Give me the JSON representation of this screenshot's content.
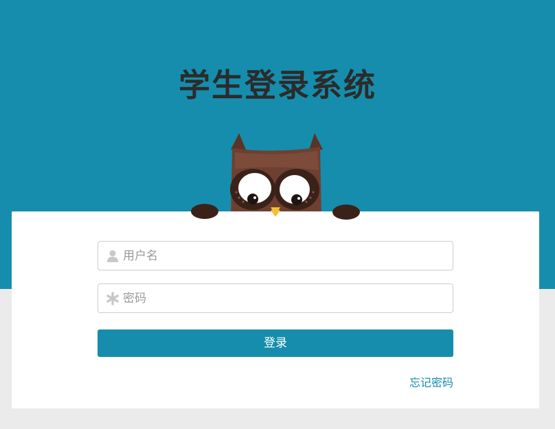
{
  "page": {
    "title": "学生登录系统"
  },
  "form": {
    "username": {
      "placeholder": "用户名",
      "value": "",
      "icon": "user-icon"
    },
    "password": {
      "placeholder": "密码",
      "value": "",
      "icon": "asterisk-icon"
    },
    "login_label": "登录",
    "forgot_label": "忘记密码"
  },
  "colors": {
    "brand": "#168dac",
    "title_text": "#2b2b2b",
    "page_bg": "#ebebeb",
    "card_bg": "#ffffff"
  }
}
